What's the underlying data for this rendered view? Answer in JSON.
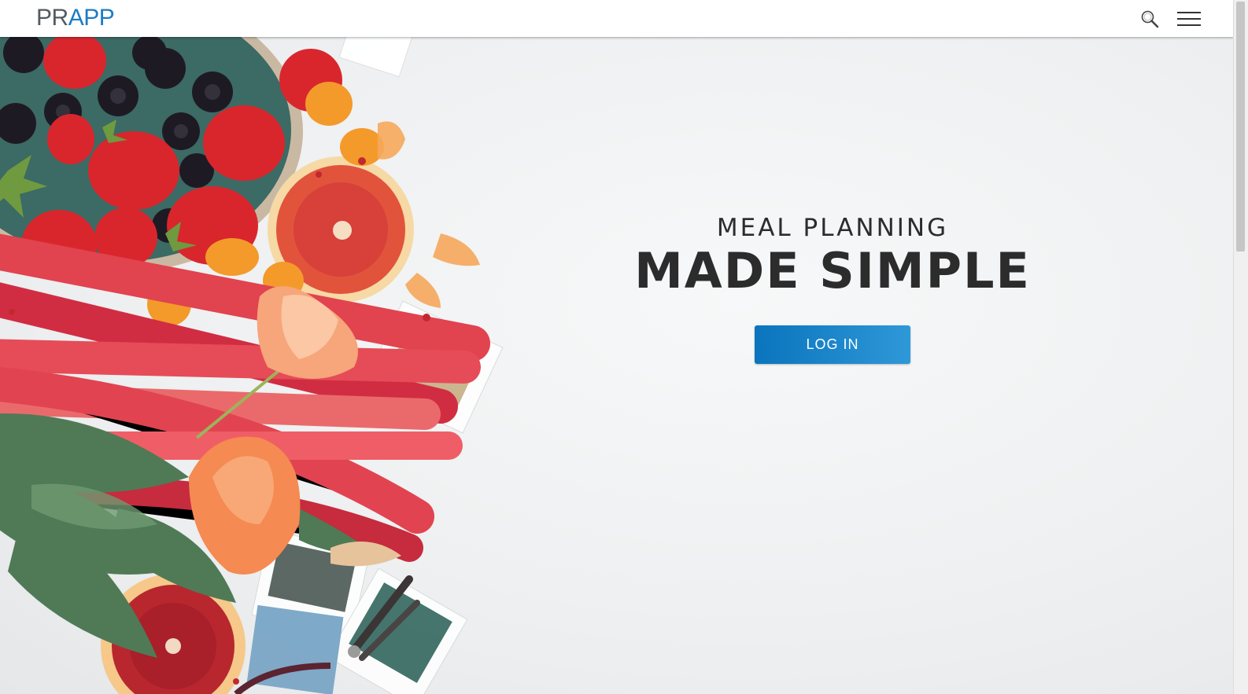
{
  "header": {
    "logo_part1": "PR",
    "logo_part2": "APP",
    "search_icon": "search-icon",
    "menu_icon": "hamburger-menu-icon"
  },
  "hero": {
    "kicker": "MEAL PLANNING",
    "headline": "MADE SIMPLE",
    "login_label": "LOG IN",
    "image": "fruit-vegetables-flowers-flatlay"
  },
  "colors": {
    "brand_blue": "#1d7cc3",
    "logo_grey": "#555b60",
    "button_blue": "#0a74bd",
    "heading_text": "#2c2c2c"
  }
}
